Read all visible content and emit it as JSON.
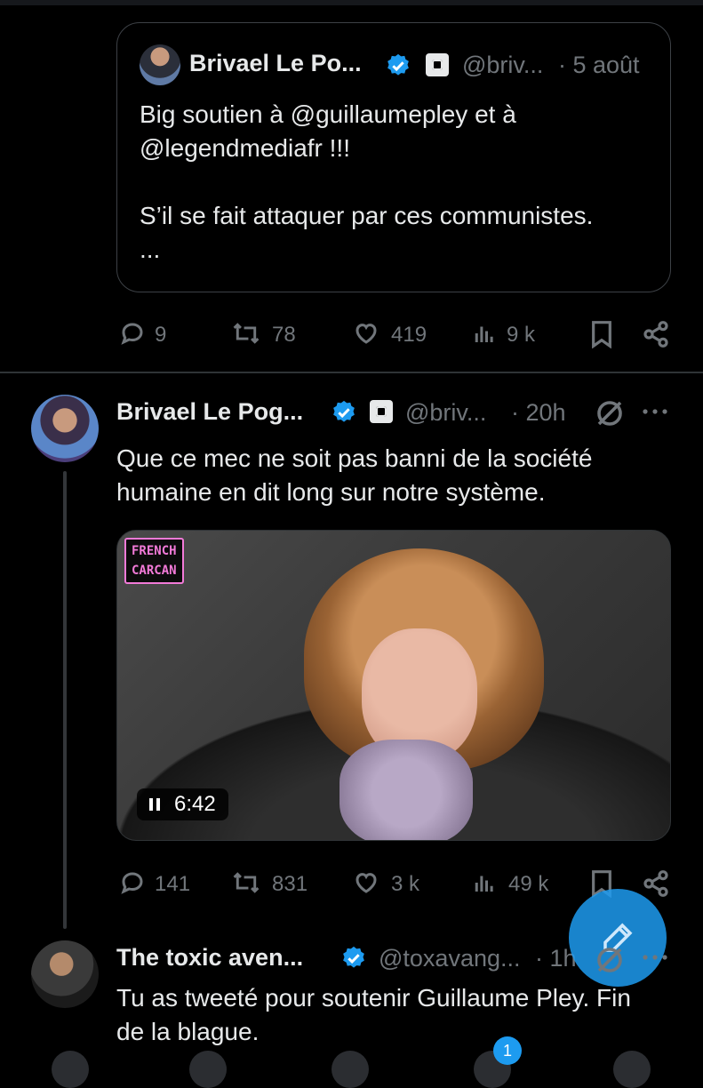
{
  "quoted": {
    "name": "Brivael Le Po...",
    "handle": "@briv...",
    "time": "· 5 août",
    "text_lines": [
      "Big soutien à @guillaumepley et à",
      "@legendmediafr !!!",
      "",
      "S’il se fait attaquer par ces communistes.",
      "..."
    ]
  },
  "quote_actions": {
    "replies": "9",
    "reposts": "78",
    "likes": "419",
    "views": "9 k"
  },
  "main_post": {
    "name": "Brivael Le Pog...",
    "handle": "@briv...",
    "time": "· 20h",
    "text_lines": [
      "Que ce mec ne soit pas banni de la société",
      "humaine en dit long sur notre système."
    ],
    "watermark_lines": [
      "FRENCH",
      "CARCAN"
    ],
    "video_duration": "6:42",
    "actions": {
      "replies": "141",
      "reposts": "831",
      "likes": "3 k",
      "views": "49 k"
    }
  },
  "reply": {
    "name": "The toxic aven...",
    "handle": "@toxavang...",
    "time": "· 1h",
    "text_lines": [
      "Tu as tweeté pour soutenir Guillaume Pley. Fin",
      "de la blague."
    ]
  },
  "nav": {
    "notifications_badge": "1"
  },
  "colors": {
    "background": "#000000",
    "accent": "#1d9bf0",
    "muted": "#71767b",
    "text": "#e7e9ea"
  }
}
